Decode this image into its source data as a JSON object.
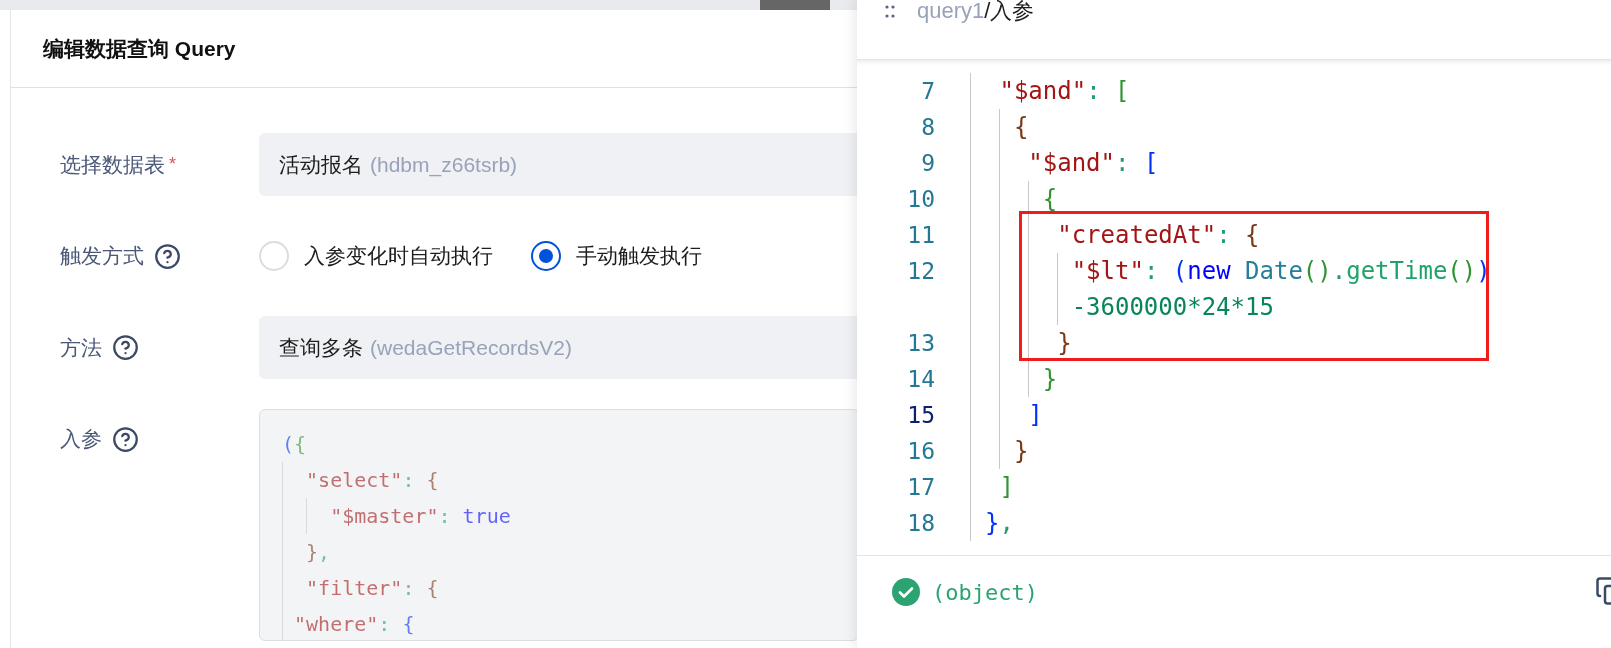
{
  "editor": {
    "title": "编辑数据查询 Query",
    "rows": [
      {
        "kind": "select",
        "label": "选择数据表",
        "required_mark": "*",
        "help": false,
        "value": "活动报名",
        "code": "(hdbm_z66tsrb)"
      },
      {
        "kind": "radio",
        "label": "触发方式",
        "help": true,
        "options": [
          {
            "label": "入参变化时自动执行",
            "selected": false
          },
          {
            "label": "手动触发执行",
            "selected": true
          }
        ]
      },
      {
        "kind": "select",
        "label": "方法",
        "help": true,
        "value": "查询多条",
        "code": "(wedaGetRecordsV2)"
      },
      {
        "kind": "code",
        "label": "入参",
        "help": true,
        "disabled": true,
        "lines": [
          {
            "tokens": [
              {
                "text": "(",
                "kind": "b1"
              },
              {
                "text": "{",
                "kind": "b2"
              }
            ]
          },
          {
            "tokens": [
              {
                "text": "  \"select\"",
                "kind": "key"
              },
              {
                "text": ": ",
                "kind": "punct"
              },
              {
                "text": "{",
                "kind": "b3"
              }
            ]
          },
          {
            "tokens": [
              {
                "text": "    \"$master\"",
                "kind": "key"
              },
              {
                "text": ": ",
                "kind": "punct"
              },
              {
                "text": "true",
                "kind": "kw"
              }
            ]
          },
          {
            "tokens": [
              {
                "text": "  }",
                "kind": "b3"
              },
              {
                "text": ",",
                "kind": "punct"
              }
            ]
          },
          {
            "tokens": [
              {
                "text": "  \"filter\"",
                "kind": "key"
              },
              {
                "text": ": ",
                "kind": "punct"
              },
              {
                "text": "{",
                "kind": "b3"
              }
            ]
          },
          {
            "tokens": [
              {
                "text": " \"where\"",
                "kind": "key"
              },
              {
                "text": ": ",
                "kind": "punct"
              },
              {
                "text": "{",
                "kind": "b1"
              }
            ]
          }
        ]
      }
    ]
  },
  "inspector": {
    "breadcrumb_parent": "query1",
    "breadcrumb_current": "/入参",
    "lines": [
      {
        "number": "7",
        "current": false,
        "highlighted": false,
        "tokens": [
          {
            "text": " \"$and\"",
            "kind": "key"
          },
          {
            "text": ": ",
            "kind": "punct"
          },
          {
            "text": "[",
            "kind": "b2"
          }
        ]
      },
      {
        "number": "8",
        "current": false,
        "highlighted": false,
        "tokens": [
          {
            "text": "  {",
            "kind": "b3"
          }
        ]
      },
      {
        "number": "9",
        "current": false,
        "highlighted": false,
        "tokens": [
          {
            "text": "   \"$and\"",
            "kind": "key"
          },
          {
            "text": ": ",
            "kind": "punct"
          },
          {
            "text": "[",
            "kind": "b1"
          }
        ]
      },
      {
        "number": "10",
        "current": false,
        "highlighted": false,
        "tokens": [
          {
            "text": "    {",
            "kind": "b2"
          }
        ]
      },
      {
        "number": "11",
        "current": false,
        "highlighted": true,
        "tokens": [
          {
            "text": "     \"createdAt\"",
            "kind": "key"
          },
          {
            "text": ": ",
            "kind": "punct"
          },
          {
            "text": "{",
            "kind": "b3"
          }
        ]
      },
      {
        "number": "12",
        "current": false,
        "highlighted": true,
        "tokens": [
          {
            "text": "      \"$lt\"",
            "kind": "key"
          },
          {
            "text": ": ",
            "kind": "punct"
          },
          {
            "text": "(",
            "kind": "b1"
          },
          {
            "text": "new ",
            "kind": "kw"
          },
          {
            "text": "Date",
            "kind": "type"
          },
          {
            "text": "()",
            "kind": "b2"
          },
          {
            "text": ".",
            "kind": "punct"
          },
          {
            "text": "getTime",
            "kind": "fn"
          },
          {
            "text": "()",
            "kind": "b2"
          },
          {
            "text": ")",
            "kind": "b1"
          }
        ]
      },
      {
        "highlighted": true,
        "tokens": [
          {
            "text": "      -3600000*24*15",
            "kind": "num"
          }
        ]
      },
      {
        "number": "13",
        "current": false,
        "highlighted": true,
        "tokens": [
          {
            "text": "     }",
            "kind": "b3"
          }
        ]
      },
      {
        "number": "14",
        "current": false,
        "highlighted": false,
        "tokens": [
          {
            "text": "    }",
            "kind": "b2"
          }
        ]
      },
      {
        "number": "15",
        "current": true,
        "highlighted": false,
        "tokens": [
          {
            "text": "   ]",
            "kind": "b1"
          }
        ]
      },
      {
        "number": "16",
        "current": false,
        "highlighted": false,
        "tokens": [
          {
            "text": "  }",
            "kind": "b3"
          }
        ]
      },
      {
        "number": "17",
        "current": false,
        "highlighted": false,
        "tokens": [
          {
            "text": " ]",
            "kind": "b2"
          }
        ]
      },
      {
        "number": "18",
        "current": false,
        "highlighted": false,
        "tokens": [
          {
            "text": "}",
            "kind": "b1"
          },
          {
            "text": ",",
            "kind": "punct"
          }
        ]
      }
    ],
    "result_ok": true,
    "result": "(object)"
  }
}
